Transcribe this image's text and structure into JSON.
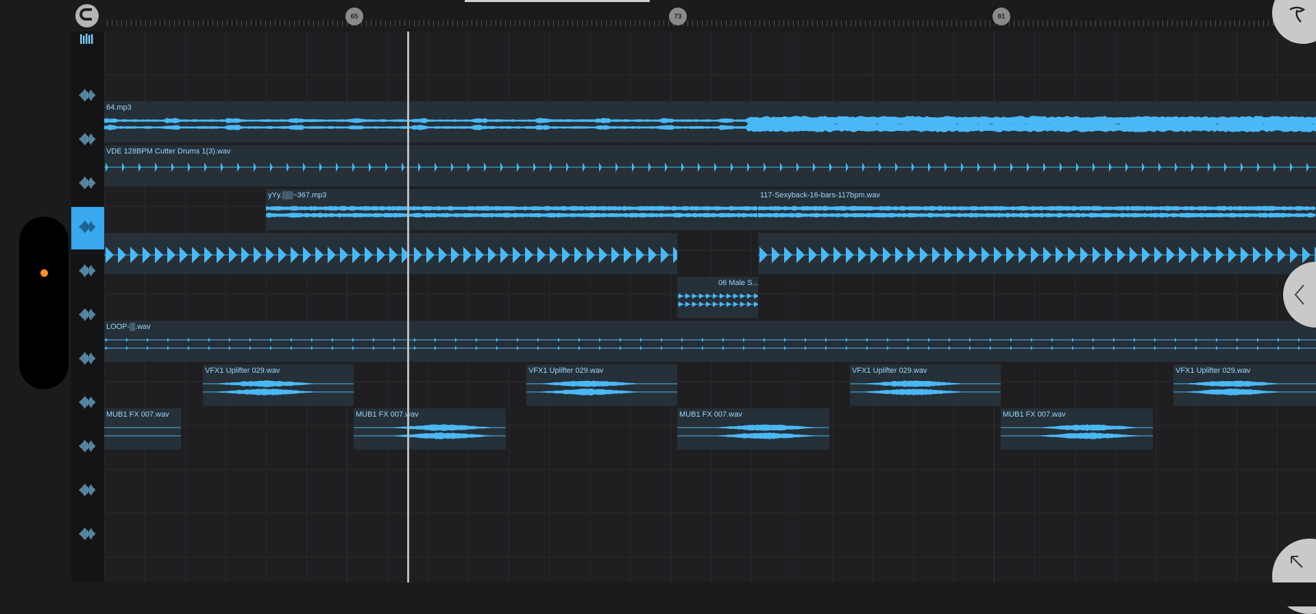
{
  "ruler": {
    "markers": [
      {
        "label": "65"
      },
      {
        "label": "73"
      },
      {
        "label": "81"
      }
    ]
  },
  "tracks": [
    {
      "icon": "mixer-icon",
      "selected": false
    },
    {
      "icon": "waveform-icon",
      "selected": false
    },
    {
      "icon": "waveform-icon",
      "selected": false
    },
    {
      "icon": "waveform-icon",
      "selected": false
    },
    {
      "icon": "waveform-icon",
      "selected": true
    },
    {
      "icon": "waveform-icon",
      "selected": false
    },
    {
      "icon": "waveform-icon",
      "selected": false
    },
    {
      "icon": "waveform-icon",
      "selected": false
    },
    {
      "icon": "waveform-icon",
      "selected": false
    },
    {
      "icon": "waveform-icon",
      "selected": false
    },
    {
      "icon": "waveform-icon",
      "selected": false
    },
    {
      "icon": "waveform-icon",
      "selected": false
    }
  ],
  "clips": {
    "mp3_64": "64.mp3",
    "cutter_drums": "VDE 128BPM Cutter Drums 1(3).wav",
    "yyy": "yYy.▒▒~367.mp3",
    "sexyback": "117-Sexyback-16-bars-117bpm.wav",
    "male": "06 Male S...",
    "loop": "LOOP-▒.wav",
    "vfx1": "VFX1 Uplifter 029.wav",
    "vfx2": "VFX1 Uplifter 029.wav",
    "vfx3": "VFX1 Uplifter 029.wav",
    "vfx4": "VFX1 Uplifter 029.wav",
    "mub1": "MUB1 FX 007.wav",
    "mub2": "MUB1 FX 007.wav",
    "mub3": "MUB1 FX 007.wav",
    "mub4": "MUB1 FX 007.wav"
  },
  "colors": {
    "waveform": "#4ab8f5",
    "selected_track": "#3aa8ef",
    "clip_bg": "#263038",
    "record_dot": "#ff8a2a"
  },
  "icons": {
    "magnet": "magnet-icon",
    "collapse_arrow": "chevron-left-icon",
    "expand": "arrow-up-left-icon",
    "logo": "app-logo-icon"
  }
}
